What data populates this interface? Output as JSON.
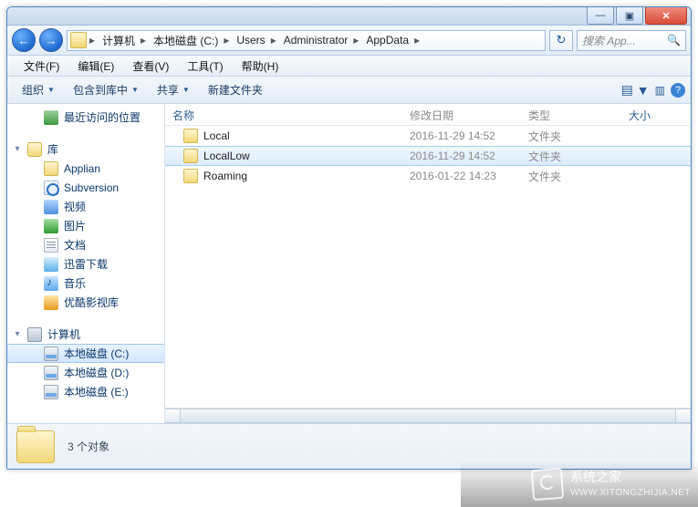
{
  "titlebar": {
    "min": "—",
    "max": "▣",
    "close": "✕"
  },
  "nav": {
    "back": "←",
    "forward": "→",
    "crumbs": [
      "计算机",
      "本地磁盘 (C:)",
      "Users",
      "Administrator",
      "AppData"
    ],
    "refresh": "↻",
    "search_placeholder": "搜索 App...",
    "search_icon": "🔍"
  },
  "menu": {
    "file": "文件(F)",
    "edit": "编辑(E)",
    "view": "查看(V)",
    "tools": "工具(T)",
    "help": "帮助(H)"
  },
  "toolbar": {
    "organize": "组织",
    "include": "包含到库中",
    "share": "共享",
    "newfolder": "新建文件夹",
    "view_icon": "▤",
    "preview_icon": "▥",
    "help_icon": "?"
  },
  "sidebar": {
    "recent": "最近访问的位置",
    "lib_header": "库",
    "items": [
      {
        "icon": "i-fold",
        "label": "Applian"
      },
      {
        "icon": "i-svn",
        "label": "Subversion"
      },
      {
        "icon": "i-vid",
        "label": "视频"
      },
      {
        "icon": "i-pic",
        "label": "图片"
      },
      {
        "icon": "i-doc",
        "label": "文档"
      },
      {
        "icon": "i-xl",
        "label": "迅雷下载"
      },
      {
        "icon": "i-mus",
        "label": "音乐"
      },
      {
        "icon": "i-yk",
        "label": "优酷影视库"
      }
    ],
    "pc_header": "计算机",
    "drives": [
      {
        "label": "本地磁盘 (C:)",
        "sel": true
      },
      {
        "label": "本地磁盘 (D:)",
        "sel": false
      },
      {
        "label": "本地磁盘 (E:)",
        "sel": false
      }
    ]
  },
  "columns": {
    "name": "名称",
    "date": "修改日期",
    "type": "类型",
    "size": "大小"
  },
  "rows": [
    {
      "name": "Local",
      "date": "2016-11-29 14:52",
      "type": "文件夹",
      "sel": false
    },
    {
      "name": "LocalLow",
      "date": "2016-11-29 14:52",
      "type": "文件夹",
      "sel": true
    },
    {
      "name": "Roaming",
      "date": "2016-01-22 14:23",
      "type": "文件夹",
      "sel": false
    }
  ],
  "status": {
    "text": "3 个对象"
  },
  "watermark": {
    "line1": "系统之家",
    "line2": "WWW.XITONGZHIJIA.NET"
  }
}
